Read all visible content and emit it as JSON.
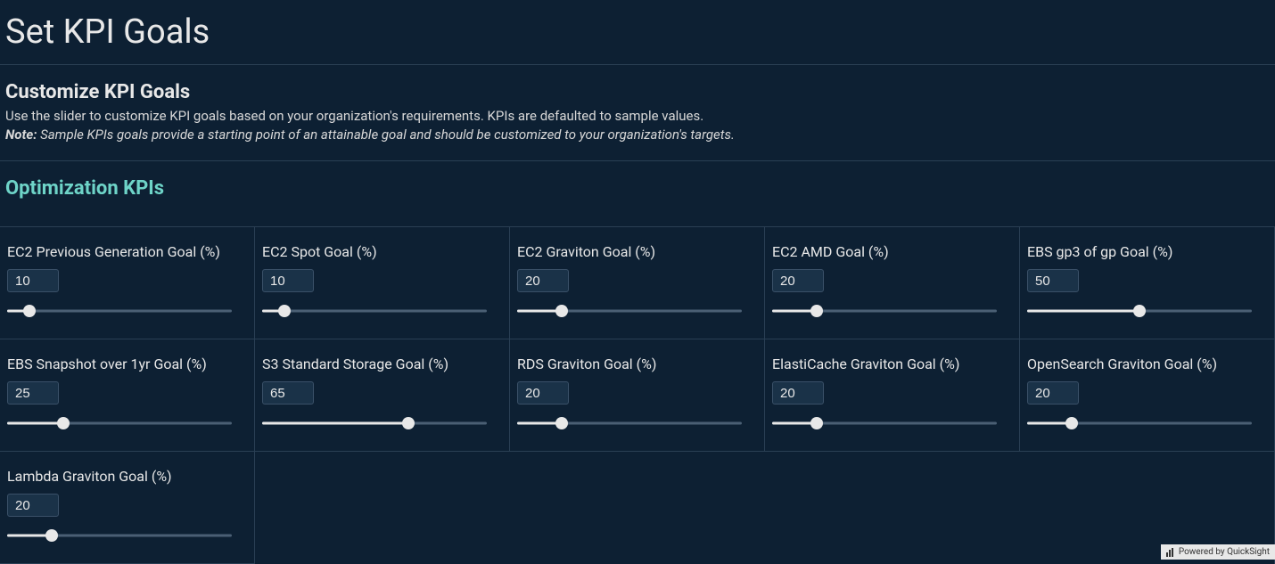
{
  "page_title": "Set KPI Goals",
  "customize": {
    "title": "Customize KPI Goals",
    "description": "Use the slider to customize KPI goals based on  your organization's requirements. KPIs are defaulted to sample values.",
    "note_label": "Note:",
    "note_text": " Sample KPIs goals provide a starting point of an attainable goal and should be customized to your organization's targets."
  },
  "optimization_title": "Optimization KPIs",
  "kpis": [
    {
      "label": "EC2 Previous Generation Goal (%)",
      "value": "10",
      "pct": 10
    },
    {
      "label": "EC2 Spot Goal (%)",
      "value": "10",
      "pct": 10
    },
    {
      "label": "EC2 Graviton Goal (%)",
      "value": "20",
      "pct": 20
    },
    {
      "label": "EC2 AMD Goal (%)",
      "value": "20",
      "pct": 20
    },
    {
      "label": "EBS gp3 of gp Goal (%)",
      "value": "50",
      "pct": 50
    },
    {
      "label": "EBS Snapshot over 1yr Goal (%)",
      "value": "25",
      "pct": 25
    },
    {
      "label": "S3 Standard Storage Goal (%)",
      "value": "65",
      "pct": 65
    },
    {
      "label": "RDS Graviton Goal (%)",
      "value": "20",
      "pct": 20
    },
    {
      "label": "ElastiCache Graviton Goal (%)",
      "value": "20",
      "pct": 20
    },
    {
      "label": "OpenSearch Graviton Goal (%)",
      "value": "20",
      "pct": 20
    },
    {
      "label": "Lambda Graviton Goal (%)",
      "value": "20",
      "pct": 20
    }
  ],
  "footer": "Powered by QuickSight"
}
